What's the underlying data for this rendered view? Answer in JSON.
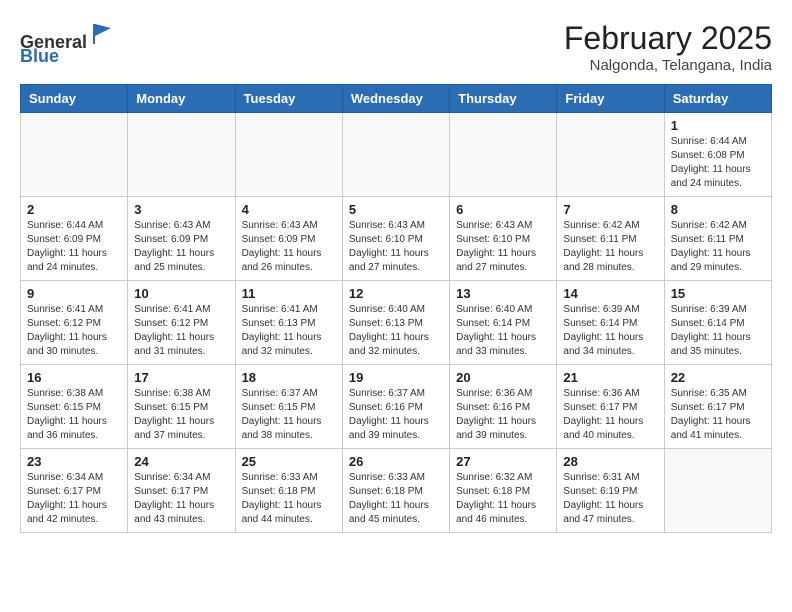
{
  "header": {
    "logo_general": "General",
    "logo_blue": "Blue",
    "month_year": "February 2025",
    "location": "Nalgonda, Telangana, India"
  },
  "calendar": {
    "days_of_week": [
      "Sunday",
      "Monday",
      "Tuesday",
      "Wednesday",
      "Thursday",
      "Friday",
      "Saturday"
    ],
    "weeks": [
      [
        {
          "day": "",
          "info": ""
        },
        {
          "day": "",
          "info": ""
        },
        {
          "day": "",
          "info": ""
        },
        {
          "day": "",
          "info": ""
        },
        {
          "day": "",
          "info": ""
        },
        {
          "day": "",
          "info": ""
        },
        {
          "day": "1",
          "info": "Sunrise: 6:44 AM\nSunset: 6:08 PM\nDaylight: 11 hours\nand 24 minutes."
        }
      ],
      [
        {
          "day": "2",
          "info": "Sunrise: 6:44 AM\nSunset: 6:09 PM\nDaylight: 11 hours\nand 24 minutes."
        },
        {
          "day": "3",
          "info": "Sunrise: 6:43 AM\nSunset: 6:09 PM\nDaylight: 11 hours\nand 25 minutes."
        },
        {
          "day": "4",
          "info": "Sunrise: 6:43 AM\nSunset: 6:09 PM\nDaylight: 11 hours\nand 26 minutes."
        },
        {
          "day": "5",
          "info": "Sunrise: 6:43 AM\nSunset: 6:10 PM\nDaylight: 11 hours\nand 27 minutes."
        },
        {
          "day": "6",
          "info": "Sunrise: 6:43 AM\nSunset: 6:10 PM\nDaylight: 11 hours\nand 27 minutes."
        },
        {
          "day": "7",
          "info": "Sunrise: 6:42 AM\nSunset: 6:11 PM\nDaylight: 11 hours\nand 28 minutes."
        },
        {
          "day": "8",
          "info": "Sunrise: 6:42 AM\nSunset: 6:11 PM\nDaylight: 11 hours\nand 29 minutes."
        }
      ],
      [
        {
          "day": "9",
          "info": "Sunrise: 6:41 AM\nSunset: 6:12 PM\nDaylight: 11 hours\nand 30 minutes."
        },
        {
          "day": "10",
          "info": "Sunrise: 6:41 AM\nSunset: 6:12 PM\nDaylight: 11 hours\nand 31 minutes."
        },
        {
          "day": "11",
          "info": "Sunrise: 6:41 AM\nSunset: 6:13 PM\nDaylight: 11 hours\nand 32 minutes."
        },
        {
          "day": "12",
          "info": "Sunrise: 6:40 AM\nSunset: 6:13 PM\nDaylight: 11 hours\nand 32 minutes."
        },
        {
          "day": "13",
          "info": "Sunrise: 6:40 AM\nSunset: 6:14 PM\nDaylight: 11 hours\nand 33 minutes."
        },
        {
          "day": "14",
          "info": "Sunrise: 6:39 AM\nSunset: 6:14 PM\nDaylight: 11 hours\nand 34 minutes."
        },
        {
          "day": "15",
          "info": "Sunrise: 6:39 AM\nSunset: 6:14 PM\nDaylight: 11 hours\nand 35 minutes."
        }
      ],
      [
        {
          "day": "16",
          "info": "Sunrise: 6:38 AM\nSunset: 6:15 PM\nDaylight: 11 hours\nand 36 minutes."
        },
        {
          "day": "17",
          "info": "Sunrise: 6:38 AM\nSunset: 6:15 PM\nDaylight: 11 hours\nand 37 minutes."
        },
        {
          "day": "18",
          "info": "Sunrise: 6:37 AM\nSunset: 6:15 PM\nDaylight: 11 hours\nand 38 minutes."
        },
        {
          "day": "19",
          "info": "Sunrise: 6:37 AM\nSunset: 6:16 PM\nDaylight: 11 hours\nand 39 minutes."
        },
        {
          "day": "20",
          "info": "Sunrise: 6:36 AM\nSunset: 6:16 PM\nDaylight: 11 hours\nand 39 minutes."
        },
        {
          "day": "21",
          "info": "Sunrise: 6:36 AM\nSunset: 6:17 PM\nDaylight: 11 hours\nand 40 minutes."
        },
        {
          "day": "22",
          "info": "Sunrise: 6:35 AM\nSunset: 6:17 PM\nDaylight: 11 hours\nand 41 minutes."
        }
      ],
      [
        {
          "day": "23",
          "info": "Sunrise: 6:34 AM\nSunset: 6:17 PM\nDaylight: 11 hours\nand 42 minutes."
        },
        {
          "day": "24",
          "info": "Sunrise: 6:34 AM\nSunset: 6:17 PM\nDaylight: 11 hours\nand 43 minutes."
        },
        {
          "day": "25",
          "info": "Sunrise: 6:33 AM\nSunset: 6:18 PM\nDaylight: 11 hours\nand 44 minutes."
        },
        {
          "day": "26",
          "info": "Sunrise: 6:33 AM\nSunset: 6:18 PM\nDaylight: 11 hours\nand 45 minutes."
        },
        {
          "day": "27",
          "info": "Sunrise: 6:32 AM\nSunset: 6:18 PM\nDaylight: 11 hours\nand 46 minutes."
        },
        {
          "day": "28",
          "info": "Sunrise: 6:31 AM\nSunset: 6:19 PM\nDaylight: 11 hours\nand 47 minutes."
        },
        {
          "day": "",
          "info": ""
        }
      ]
    ]
  }
}
